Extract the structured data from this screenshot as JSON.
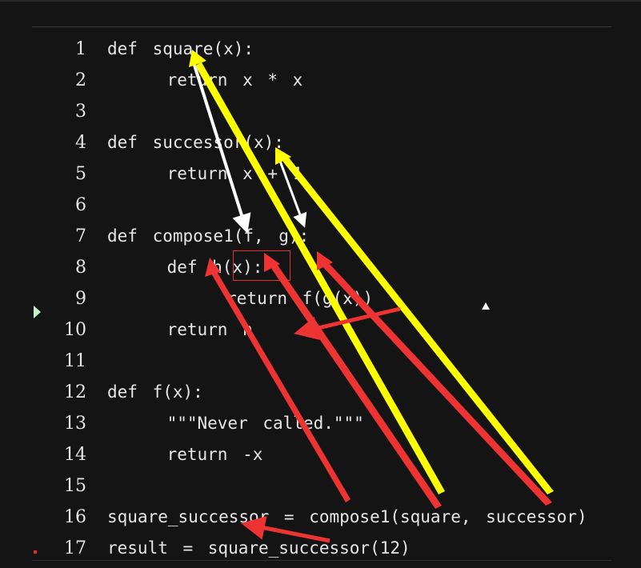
{
  "editor": {
    "lines": [
      {
        "num": "1",
        "code": "def square(x):"
      },
      {
        "num": "2",
        "code": "    return x * x"
      },
      {
        "num": "3",
        "code": ""
      },
      {
        "num": "4",
        "code": "def successor(x):"
      },
      {
        "num": "5",
        "code": "    return x + 1"
      },
      {
        "num": "6",
        "code": ""
      },
      {
        "num": "7",
        "code": "def compose1(f, g):"
      },
      {
        "num": "8",
        "code": "    def h(x):"
      },
      {
        "num": "9",
        "code": "        return f(g(x))"
      },
      {
        "num": "10",
        "code": "    return h"
      },
      {
        "num": "11",
        "code": ""
      },
      {
        "num": "12",
        "code": "def f(x):"
      },
      {
        "num": "13",
        "code": "    \"\"\"Never called.\"\"\""
      },
      {
        "num": "14",
        "code": "    return -x"
      },
      {
        "num": "15",
        "code": ""
      },
      {
        "num": "16",
        "code": "square_successor = compose1(square, successor)"
      },
      {
        "num": "17",
        "code": "result = square_successor(12)"
      }
    ]
  },
  "annotations": {
    "colors": {
      "white": "#ffffff",
      "yellow": "#ffff00",
      "red": "#ee3333"
    }
  }
}
